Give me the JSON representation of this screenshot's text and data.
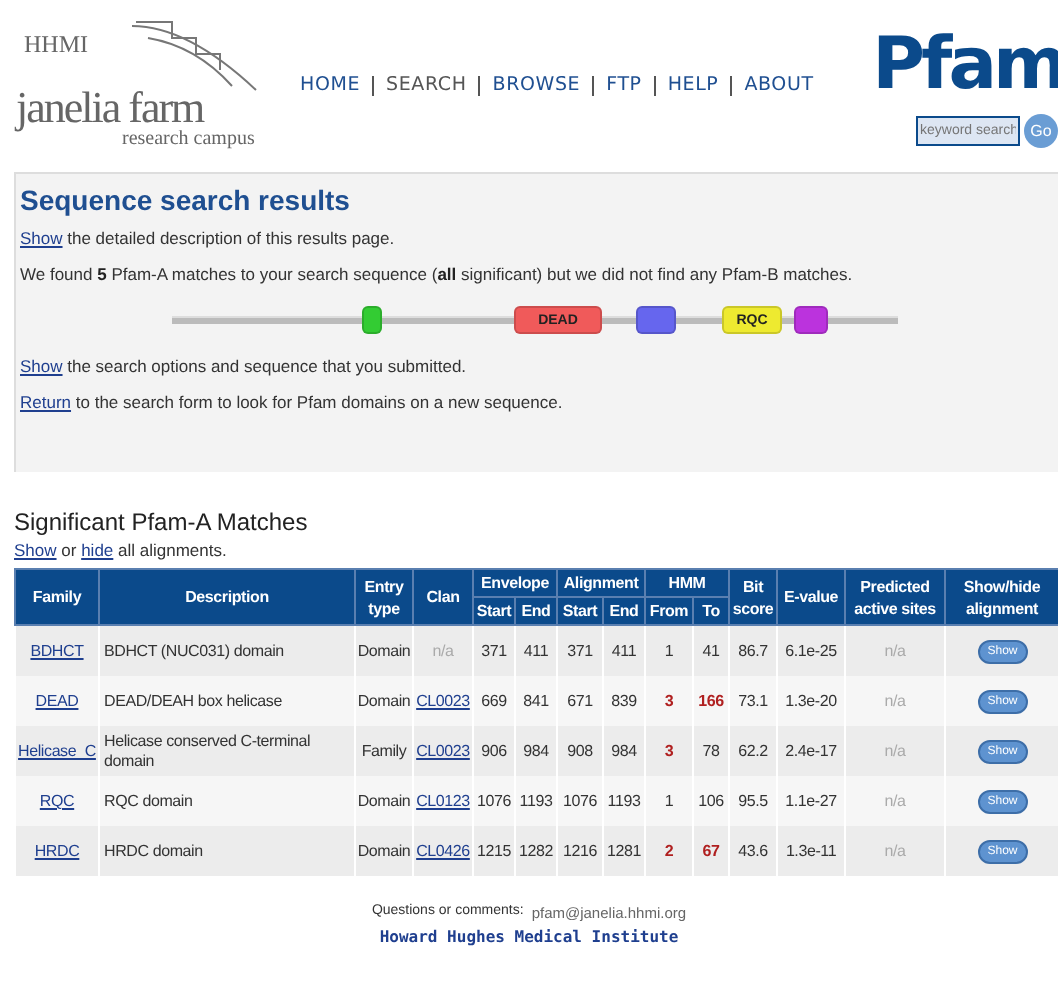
{
  "header": {
    "logo": {
      "top": "HHMI",
      "main": "janelia farm",
      "sub": "research campus"
    },
    "nav": [
      {
        "label": "HOME",
        "selected": false
      },
      {
        "label": "SEARCH",
        "selected": true
      },
      {
        "label": "BROWSE",
        "selected": false
      },
      {
        "label": "FTP",
        "selected": false
      },
      {
        "label": "HELP",
        "selected": false
      },
      {
        "label": "ABOUT",
        "selected": false
      }
    ],
    "brand": "Pfam",
    "search": {
      "placeholder": "keyword search"
    },
    "go": "Go"
  },
  "results": {
    "title": "Sequence search results",
    "lines": [
      {
        "link": "Show",
        "text": " the detailed description of this results page."
      },
      {
        "text": "We found **5** Pfam-A matches to your search sequence (**all** significant) but we did not find any Pfam-B matches."
      },
      {
        "kind": "domains",
        "domains": [
          {
            "color": "#33cc33"
          },
          {
            "color": "#f05a5a",
            "label": "DEAD"
          },
          {
            "color": "#6666ee"
          },
          {
            "color": "#eeea30",
            "label": "RQC"
          },
          {
            "color": "#bb33dd"
          }
        ]
      },
      {
        "link": "Show",
        "text": " the search options and sequence that you submitted."
      },
      {
        "link": "Return",
        "text": " to the search form to look for Pfam domains on a new sequence."
      }
    ]
  },
  "matches": {
    "title": "Significant Pfam-A Matches",
    "toggle": {
      "show": "Show",
      "mid": "or",
      "hide": "hide",
      "tail": "all alignments."
    },
    "columns": [
      {
        "label": "Family"
      },
      {
        "label": "Description"
      },
      {
        "label": "Entry type"
      },
      {
        "label": "Clan"
      },
      {
        "label": "Envelope",
        "sub": [
          "Start",
          "End"
        ]
      },
      {
        "label": "Alignment",
        "sub": [
          "Start",
          "End"
        ]
      },
      {
        "label": "HMM",
        "sub": [
          "From",
          "To"
        ]
      },
      {
        "label": "Bit score"
      },
      {
        "label": "E-value"
      },
      {
        "label": "Predicted active sites"
      },
      {
        "label": "Show/hide alignment"
      }
    ],
    "rows": [
      {
        "family": "BDHCT",
        "description": "BDHCT (NUC031) domain",
        "entry_type": "Domain",
        "clan": "n/a",
        "clan_linked": false,
        "env_start": "371",
        "env_end": "411",
        "ali_start": "371",
        "ali_end": "411",
        "hmm_from": "1",
        "hmm_from_flag": false,
        "hmm_to": "41",
        "hmm_to_flag": false,
        "bit_score": "86.7",
        "e_value": "6.1e-25",
        "active_sites": "n/a",
        "button": "Show"
      },
      {
        "family": "DEAD",
        "description": "DEAD/DEAH box helicase",
        "entry_type": "Domain",
        "clan": "CL0023",
        "clan_linked": true,
        "env_start": "669",
        "env_end": "841",
        "ali_start": "671",
        "ali_end": "839",
        "hmm_from": "3",
        "hmm_from_flag": true,
        "hmm_to": "166",
        "hmm_to_flag": true,
        "bit_score": "73.1",
        "e_value": "1.3e-20",
        "active_sites": "n/a",
        "button": "Show"
      },
      {
        "family": "Helicase_C",
        "description": "Helicase conserved C-terminal domain",
        "entry_type": "Family",
        "clan": "CL0023",
        "clan_linked": true,
        "env_start": "906",
        "env_end": "984",
        "ali_start": "908",
        "ali_end": "984",
        "hmm_from": "3",
        "hmm_from_flag": true,
        "hmm_to": "78",
        "hmm_to_flag": false,
        "bit_score": "62.2",
        "e_value": "2.4e-17",
        "active_sites": "n/a",
        "button": "Show"
      },
      {
        "family": "RQC",
        "description": "RQC domain",
        "entry_type": "Domain",
        "clan": "CL0123",
        "clan_linked": true,
        "env_start": "1076",
        "env_end": "1193",
        "ali_start": "1076",
        "ali_end": "1193",
        "hmm_from": "1",
        "hmm_from_flag": false,
        "hmm_to": "106",
        "hmm_to_flag": false,
        "bit_score": "95.5",
        "e_value": "1.1e-27",
        "active_sites": "n/a",
        "button": "Show"
      },
      {
        "family": "HRDC",
        "description": "HRDC domain",
        "entry_type": "Domain",
        "clan": "CL0426",
        "clan_linked": true,
        "env_start": "1215",
        "env_end": "1282",
        "ali_start": "1216",
        "ali_end": "1281",
        "hmm_from": "2",
        "hmm_from_flag": true,
        "hmm_to": "67",
        "hmm_to_flag": true,
        "bit_score": "43.6",
        "e_value": "1.3e-11",
        "active_sites": "n/a",
        "button": "Show"
      }
    ]
  },
  "footer": {
    "label": "Questions or comments:",
    "email": "pfam@janelia.hhmi.org",
    "institute": "Howard Hughes Medical Institute"
  }
}
